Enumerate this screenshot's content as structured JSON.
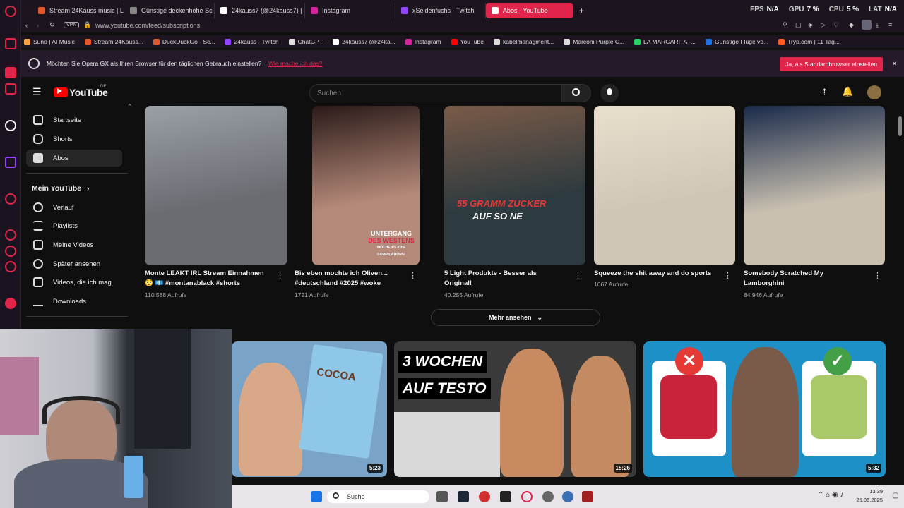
{
  "browser": {
    "tabs": [
      {
        "label": "Stream 24Kauss music | L",
        "color": "#e8572a"
      },
      {
        "label": "Günstige deckenhohe Sc",
        "color": "#888888"
      },
      {
        "label": "24kauss7 (@24kauss7) |",
        "color": "#111111"
      },
      {
        "label": "Instagram",
        "color": "#d6249f"
      },
      {
        "label": "xSeidenfuchs - Twitch",
        "color": "#9146ff"
      },
      {
        "label": "Abos - YouTube",
        "color": "#ff0000",
        "active": true
      }
    ],
    "stats": {
      "fps_label": "FPS",
      "fps_value": "N/A",
      "gpu_label": "GPU",
      "gpu_value": "7 %",
      "cpu_label": "CPU",
      "cpu_value": "5 %",
      "lat_label": "LAT",
      "lat_value": "N/A"
    },
    "vpn_label": "VPN",
    "url": "www.youtube.com/feed/subscriptions",
    "bookmarks": [
      {
        "label": "Suno | AI Music",
        "color": "#f4a340"
      },
      {
        "label": "Stream 24Kauss...",
        "color": "#e8572a"
      },
      {
        "label": "DuckDuckGo - Sc...",
        "color": "#de5833"
      },
      {
        "label": "24kauss - Twitch",
        "color": "#9146ff"
      },
      {
        "label": "ChatGPT",
        "color": "#dddddd"
      },
      {
        "label": "24kauss7 (@24ka...",
        "color": "#ffffff"
      },
      {
        "label": "Instagram",
        "color": "#d6249f"
      },
      {
        "label": "YouTube",
        "color": "#ff0000"
      },
      {
        "label": "kabelmanagment...",
        "color": "#dddddd"
      },
      {
        "label": "Marconi Purple C...",
        "color": "#dddddd"
      },
      {
        "label": "LA MARGARITA -...",
        "color": "#25d366"
      },
      {
        "label": "Günstige Flüge vo...",
        "color": "#1a73e8"
      },
      {
        "label": "Tryp.com | 11 Tag...",
        "color": "#ff5a1f"
      }
    ],
    "promo": {
      "text": "Möchten Sie Opera GX als Ihren Browser für den täglichen Gebrauch einstellen?",
      "link": "Wie mache ich das?",
      "button": "Ja, als Standardbrowser einstellen",
      "close": "×"
    }
  },
  "youtube": {
    "logo": "YouTube",
    "logo_country": "DE",
    "search_placeholder": "Suchen",
    "guide": {
      "items": [
        {
          "label": "Startseite",
          "icon": "home-icon"
        },
        {
          "label": "Shorts",
          "icon": "shorts-icon"
        },
        {
          "label": "Abos",
          "icon": "subscriptions-icon",
          "active": true
        }
      ],
      "section_title": "Mein YouTube",
      "section_items": [
        {
          "label": "Verlauf",
          "icon": "history-icon"
        },
        {
          "label": "Playlists",
          "icon": "playlists-icon"
        },
        {
          "label": "Meine Videos",
          "icon": "my-videos-icon"
        },
        {
          "label": "Später ansehen",
          "icon": "watch-later-icon"
        },
        {
          "label": "Videos, die ich mag",
          "icon": "liked-icon"
        },
        {
          "label": "Downloads",
          "icon": "download-icon"
        }
      ]
    },
    "shorts": [
      {
        "title_line1": "Monte LEAKT IRL Stream Einnahmen",
        "title_line2": "😳 💶 #montanablack #shorts",
        "views": "110.588 Aufrufe",
        "bg": "#6a6c72",
        "accent": "#9aa0a6"
      },
      {
        "title_line1": "Bis eben mochte ich Oliven...",
        "title_line2": "#deutschland #2025 #woke",
        "views": "1721 Aufrufe",
        "bg": "#b68a7a",
        "accent": "#2a1a18",
        "overlay_line1": "UNTERGANG",
        "overlay_line2": "DES WESTENS",
        "overlay_line3": "WÖCHENTLICHE COMPILATIONS!"
      },
      {
        "title_line1": "5 Light Produkte - Besser als",
        "title_line2": "Original!",
        "views": "40.255 Aufrufe",
        "bg": "#2d3a3f",
        "accent": "#7a5a48",
        "overlay_line1": "55 GRAMM ZUCKER",
        "overlay_line2": "AUF SO NE"
      },
      {
        "title_line1": "Squeeze the shit away and do sports",
        "title_line2": "",
        "views": "1067 Aufrufe",
        "bg": "#cfc6b8",
        "accent": "#e8dfcc"
      },
      {
        "title_line1": "Somebody Scratched My",
        "title_line2": "Lamborghini",
        "views": "84.946 Aufrufe",
        "bg": "#c9c0b0",
        "accent": "#1a2a4a"
      }
    ],
    "more_button": "Mehr ansehen",
    "videos": [
      {
        "duration": "5:23",
        "bg": "#7aa3c8",
        "overlay": "COCOA"
      },
      {
        "duration": "15:26",
        "bg": "#3a3a3a",
        "overlay_line1": "3 WOCHEN",
        "overlay_line2": "AUF TESTO"
      },
      {
        "duration": "5:32",
        "bg": "#1e90c8",
        "overlay": ""
      }
    ]
  },
  "taskbar": {
    "search_label": "Suche",
    "time": "13:39",
    "date": "25.06.2025"
  },
  "colors": {
    "opera_red": "#e0244a",
    "yt_red": "#ff0000",
    "bg": "#0f0f0f"
  }
}
